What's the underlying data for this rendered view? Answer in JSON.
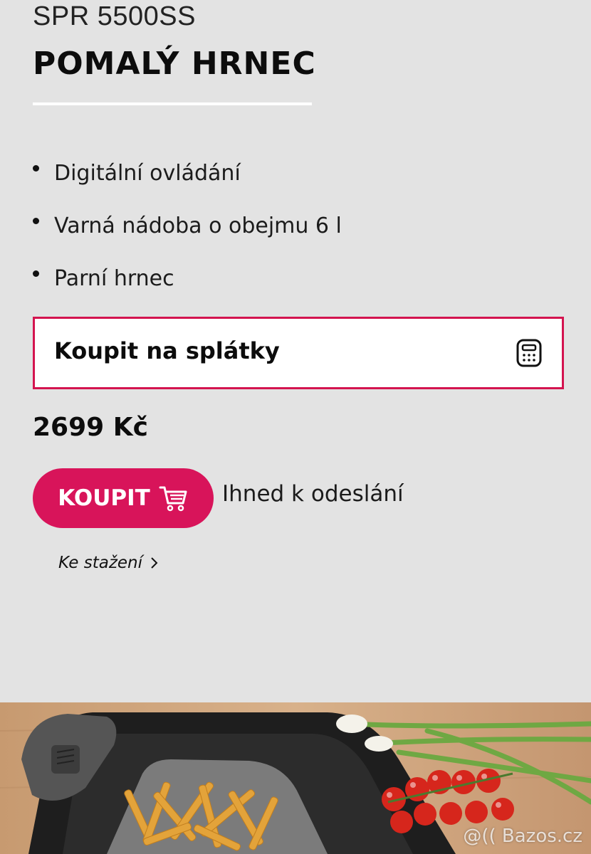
{
  "product": {
    "model": "SPR 5500SS",
    "title": "POMALÝ HRNEC",
    "features": [
      "Digitální ovládání",
      "Varná nádoba o obejmu 6 l",
      "Parní hrnec"
    ],
    "installment_label": "Koupit na splátky",
    "price": "2699 Kč",
    "buy_label": "KOUPIT",
    "availability": "Ihned k odeslání",
    "download_label": "Ke stažení"
  },
  "icons": {
    "installment": "calculator-icon",
    "buy": "cart-icon",
    "download": "chevron-right-icon"
  },
  "watermark": "@(( Bazos.cz",
  "colors": {
    "accent": "#d8145a",
    "border": "#d4144f",
    "background": "#e3e3e3"
  }
}
